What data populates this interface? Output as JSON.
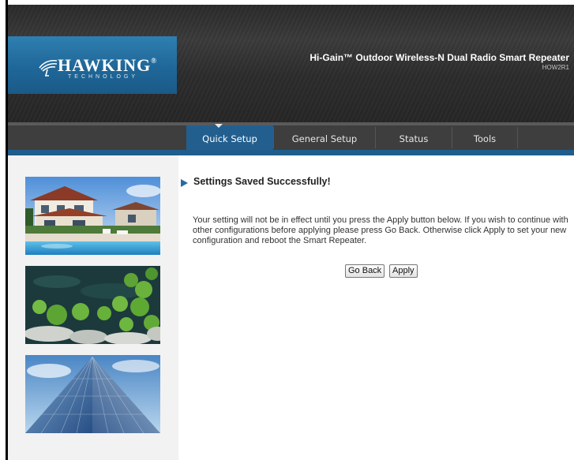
{
  "brand": {
    "name": "HAWKING",
    "registered": "®",
    "tagline": "TECHNOLOGY"
  },
  "product": {
    "title": "Hi-Gain™ Outdoor Wireless-N Dual Radio Smart Repeater",
    "model": "HOW2R1"
  },
  "nav": {
    "tabs": [
      {
        "label": "Quick Setup",
        "active": true
      },
      {
        "label": "General Setup",
        "active": false
      },
      {
        "label": "Status",
        "active": false
      },
      {
        "label": "Tools",
        "active": false
      }
    ]
  },
  "sidebar": {
    "images": [
      "house-pool-photo",
      "lily-pond-photo",
      "glass-building-photo"
    ]
  },
  "main": {
    "heading": "Settings Saved Successfully!",
    "message": "Your setting will not be in effect until you press the Apply button below. If you wish to continue with other configurations before applying please press Go Back. Otherwise click Apply to set your new configuration and reboot the Smart Repeater.",
    "buttons": {
      "go_back": "Go Back",
      "apply": "Apply"
    }
  },
  "colors": {
    "accent": "#235f8e",
    "header_bg": "#2f2f2f",
    "sidebar_bg": "#f2f2f2"
  }
}
